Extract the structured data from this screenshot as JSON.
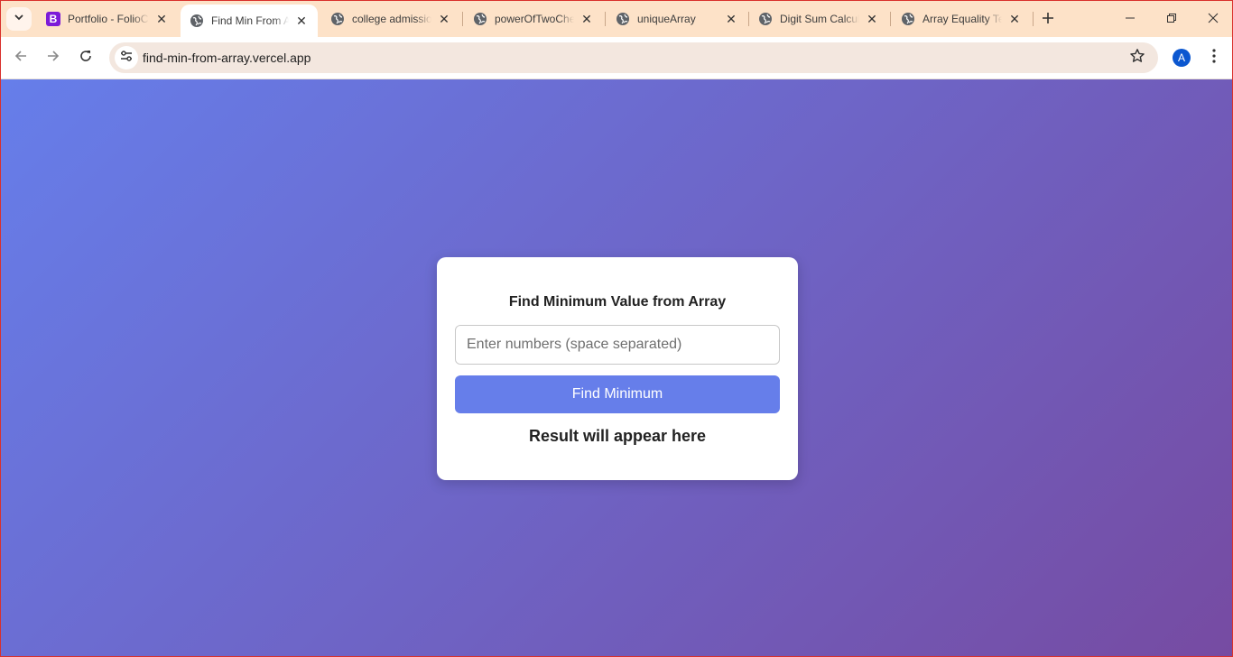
{
  "browser": {
    "tabs": [
      {
        "title": "Portfolio - FolioC",
        "icon": "bootstrap-b-icon",
        "active": false
      },
      {
        "title": "Find Min From Array",
        "icon": "globe-icon",
        "active": true
      },
      {
        "title": "college admission",
        "icon": "globe-icon",
        "active": false
      },
      {
        "title": "powerOfTwoChecker",
        "icon": "globe-icon",
        "active": false
      },
      {
        "title": "uniqueArray",
        "icon": "globe-icon",
        "active": false
      },
      {
        "title": "Digit Sum Calculator",
        "icon": "globe-icon",
        "active": false
      },
      {
        "title": "Array Equality Test",
        "icon": "globe-icon",
        "active": false
      }
    ],
    "first_tab_favicon_letter": "B",
    "url": "find-min-from-array.vercel.app",
    "profile_initial": "A",
    "colors": {
      "tabstrip_bg": "#fde2c8",
      "omnibox_bg": "#f3e7df",
      "profile_bg": "#0b57d0",
      "window_border": "#d9302c"
    }
  },
  "page": {
    "title": "Find Minimum Value from Array",
    "input": {
      "value": "",
      "placeholder": "Enter numbers (space separated)"
    },
    "button_label": "Find Minimum",
    "result_text": "Result will appear here",
    "colors": {
      "gradient_start": "#667eea",
      "gradient_end": "#764ba2",
      "button_bg": "#667eea",
      "card_bg": "#ffffff"
    }
  }
}
